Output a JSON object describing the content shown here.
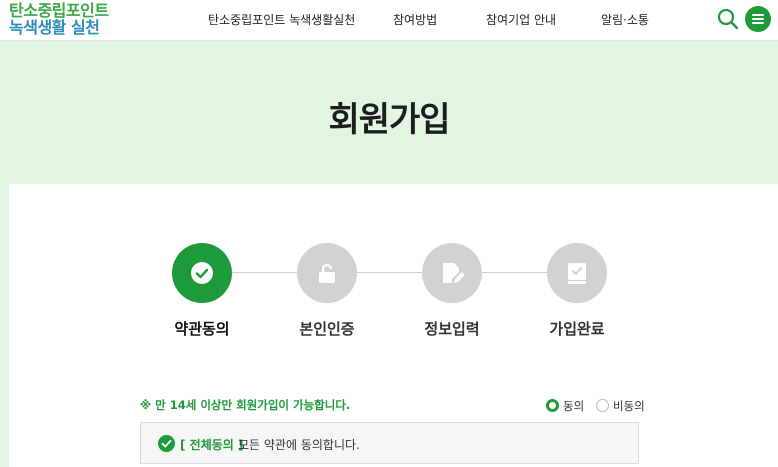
{
  "header": {
    "logo_line1": "탄소중립포인트",
    "logo_line2": "녹색생활 실천",
    "nav": [
      {
        "label": "탄소중립포인트 녹색생활실천"
      },
      {
        "label": "참여방법"
      },
      {
        "label": "참여기업 안내"
      },
      {
        "label": "알림·소통"
      }
    ],
    "search_icon": "search-icon",
    "menu_icon": "hamburger-menu-icon"
  },
  "page": {
    "title": "회원가입"
  },
  "steps": [
    {
      "label": "약관동의",
      "icon": "check-icon",
      "active": true
    },
    {
      "label": "본인인증",
      "icon": "lock-icon",
      "active": false
    },
    {
      "label": "정보입력",
      "icon": "edit-icon",
      "active": false
    },
    {
      "label": "가입완료",
      "icon": "check-document-icon",
      "active": false
    }
  ],
  "agreement": {
    "notice": "※ 만 14세 이상만 회원가입이 가능합니다.",
    "agree_label": "동의",
    "disagree_label": "비동의",
    "selected": "동의",
    "all_agree_strong": "[ 전체동의 ]",
    "all_agree_text": "모든 약관에 동의합니다."
  },
  "colors": {
    "brand_green": "#1f9a3a",
    "hero_bg": "#e2f4e2",
    "inactive_step": "#d2d2d2"
  }
}
